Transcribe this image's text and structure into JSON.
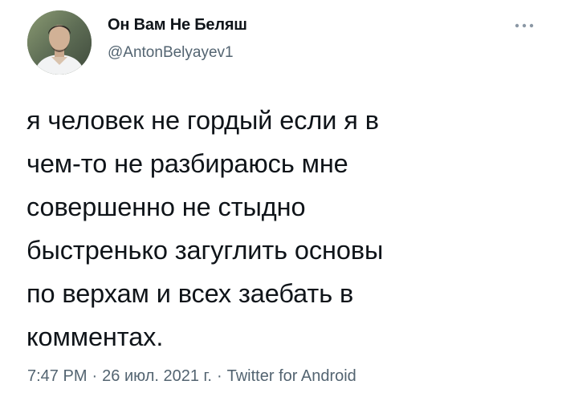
{
  "author": {
    "display_name": "Он Вам Не Беляш",
    "handle": "@AntonBelyayev1"
  },
  "tweet": {
    "text": "я человек не гордый если я в\nчем-то не разбираюсь мне\nсовершенно не стыдно\nбыстренько загуглить основы\nпо верхам и всех заебать в\nкомментах."
  },
  "meta": {
    "time": "7:47 PM",
    "separator": "·",
    "date": "26 июл. 2021 г.",
    "source": "Twitter for Android"
  },
  "icons": {
    "more": "more-horizontal-icon",
    "avatar": "profile-photo"
  },
  "colors": {
    "text": "#0f1419",
    "secondary": "#536471",
    "background": "#ffffff"
  }
}
